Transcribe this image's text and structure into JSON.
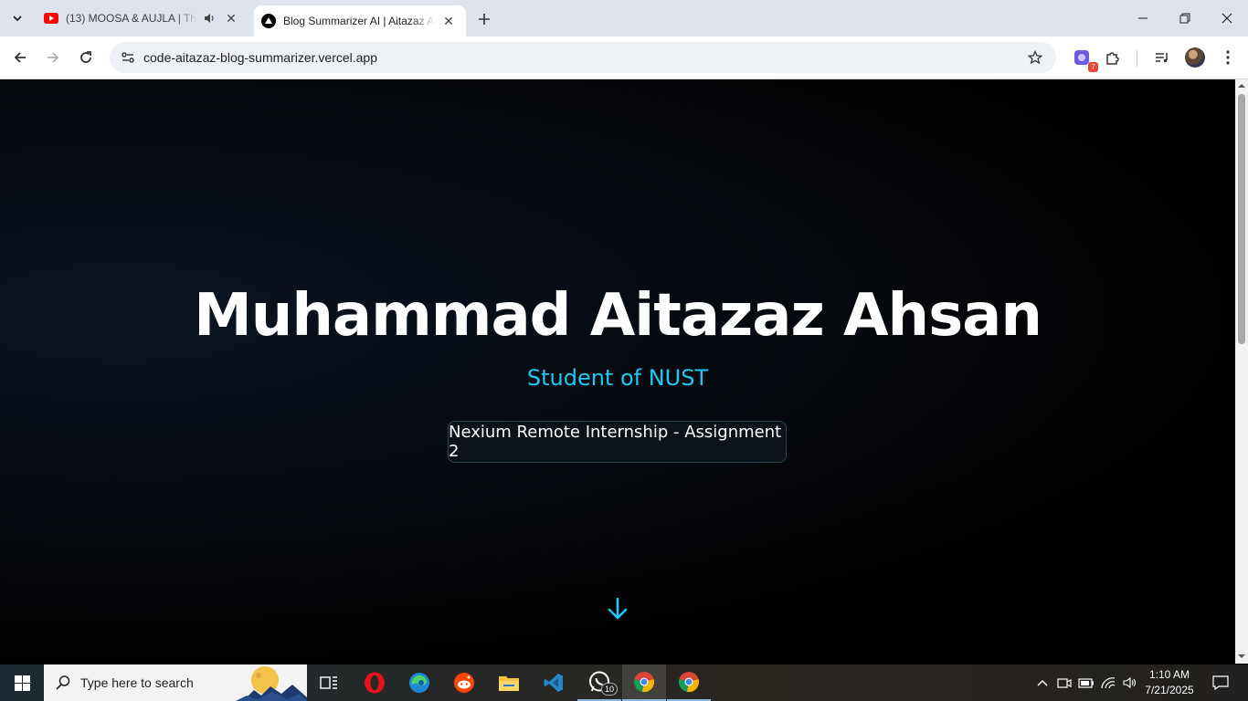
{
  "browser": {
    "tabs": [
      {
        "title": "(13) MOOSA & AUJLA | The",
        "active": false,
        "audio": true,
        "favicon": "youtube-icon"
      },
      {
        "title": "Blog Summarizer AI | Aitazaz Ah",
        "active": true,
        "audio": false,
        "favicon": "vercel-icon"
      }
    ],
    "url": "code-aitazaz-blog-summarizer.vercel.app",
    "extension_badge": "7"
  },
  "page": {
    "name": "Muhammad Aitazaz Ahsan",
    "subtitle": "Student of NUST",
    "badge": "Nexium Remote Internship - Assignment 2",
    "accent_color": "#1ec8f0"
  },
  "taskbar": {
    "search_placeholder": "Type here to search",
    "whatsapp_badge": "10",
    "time": "1:10 AM",
    "date": "7/21/2025"
  }
}
